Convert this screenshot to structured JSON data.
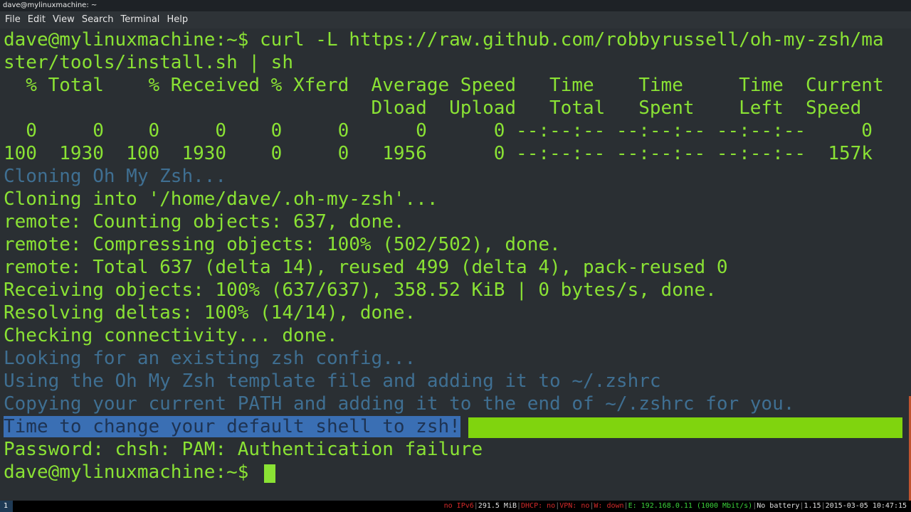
{
  "window": {
    "title": "dave@mylinuxmachine: ~"
  },
  "menu": [
    "File",
    "Edit",
    "View",
    "Search",
    "Terminal",
    "Help"
  ],
  "terminal": {
    "lines": [
      "dave@mylinuxmachine:~$ curl -L https://raw.github.com/robbyrussell/oh-my-zsh/ma",
      "ster/tools/install.sh | sh",
      "  % Total    % Received % Xferd  Average Speed   Time    Time     Time  Current",
      "                                 Dload  Upload   Total   Spent    Left  Speed",
      "  0     0    0     0    0     0      0      0 --:--:-- --:--:-- --:--:--     0",
      "100  1930  100  1930    0     0   1956      0 --:--:-- --:--:-- --:--:--  157k",
      "Cloning Oh My Zsh...",
      "Cloning into '/home/dave/.oh-my-zsh'...",
      "remote: Counting objects: 637, done.",
      "remote: Compressing objects: 100% (502/502), done.",
      "remote: Total 637 (delta 14), reused 499 (delta 4), pack-reused 0",
      "Receiving objects: 100% (637/637), 358.52 KiB | 0 bytes/s, done.",
      "Resolving deltas: 100% (14/14), done.",
      "Checking connectivity... done.",
      "Looking for an existing zsh config...",
      "Using the Oh My Zsh template file and adding it to ~/.zshrc",
      "Copying your current PATH and adding it to the end of ~/.zshrc for you.",
      "Time to change your default shell to zsh!",
      "Password: chsh: PAM: Authentication failure",
      "dave@mylinuxmachine:~$ "
    ]
  },
  "statusbar": {
    "workspace": "1",
    "ipv6": "no IPv6",
    "memory": "291.5 MiB",
    "dhcp": "DHCP: no",
    "vpn": "VPN: no",
    "w": "W: down",
    "e": "E: 192.168.0.11 (1000 Mbit/s)",
    "battery": "No battery",
    "load": "1.15",
    "datetime": "2015-03-05 10:47:15"
  },
  "colors": {
    "background": "#2a2f33",
    "text_green": "#8ae234",
    "text_dim_blue": "#3f6f92",
    "highlight_green": "#80d40e",
    "highlight_blue": "#3a6fb4"
  }
}
